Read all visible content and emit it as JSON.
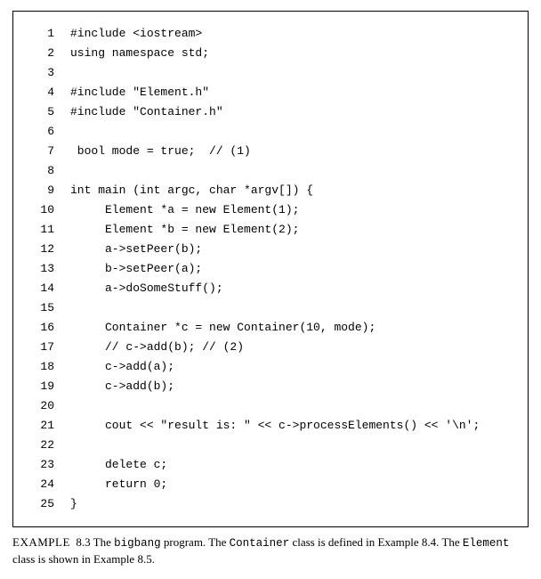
{
  "code": {
    "lines": [
      {
        "n": "1",
        "t": "#include <iostream>"
      },
      {
        "n": "2",
        "t": "using namespace std;"
      },
      {
        "n": "3",
        "t": ""
      },
      {
        "n": "4",
        "t": "#include \"Element.h\""
      },
      {
        "n": "5",
        "t": "#include \"Container.h\""
      },
      {
        "n": "6",
        "t": ""
      },
      {
        "n": "7",
        "t": " bool mode = true;  // (1)"
      },
      {
        "n": "8",
        "t": ""
      },
      {
        "n": "9",
        "t": "int main (int argc, char *argv[]) {"
      },
      {
        "n": "10",
        "t": "     Element *a = new Element(1);"
      },
      {
        "n": "11",
        "t": "     Element *b = new Element(2);"
      },
      {
        "n": "12",
        "t": "     a->setPeer(b);"
      },
      {
        "n": "13",
        "t": "     b->setPeer(a);"
      },
      {
        "n": "14",
        "t": "     a->doSomeStuff();"
      },
      {
        "n": "15",
        "t": ""
      },
      {
        "n": "16",
        "t": "     Container *c = new Container(10, mode);"
      },
      {
        "n": "17",
        "t": "     // c->add(b); // (2)"
      },
      {
        "n": "18",
        "t": "     c->add(a);"
      },
      {
        "n": "19",
        "t": "     c->add(b);"
      },
      {
        "n": "20",
        "t": ""
      },
      {
        "n": "21",
        "t": "     cout << \"result is: \" << c->processElements() << '\\n';"
      },
      {
        "n": "22",
        "t": ""
      },
      {
        "n": "23",
        "t": "     delete c;"
      },
      {
        "n": "24",
        "t": "     return 0;"
      },
      {
        "n": "25",
        "t": "}"
      }
    ]
  },
  "caption": {
    "label": "EXAMPLE",
    "number": "8.3",
    "text_1": " The ",
    "prog_name": "bigbang",
    "text_2": " program. The ",
    "class1": "Container",
    "text_3": " class is defined in Example 8.4. The ",
    "class2": "Element",
    "text_4": " class is shown in Example 8.5."
  }
}
